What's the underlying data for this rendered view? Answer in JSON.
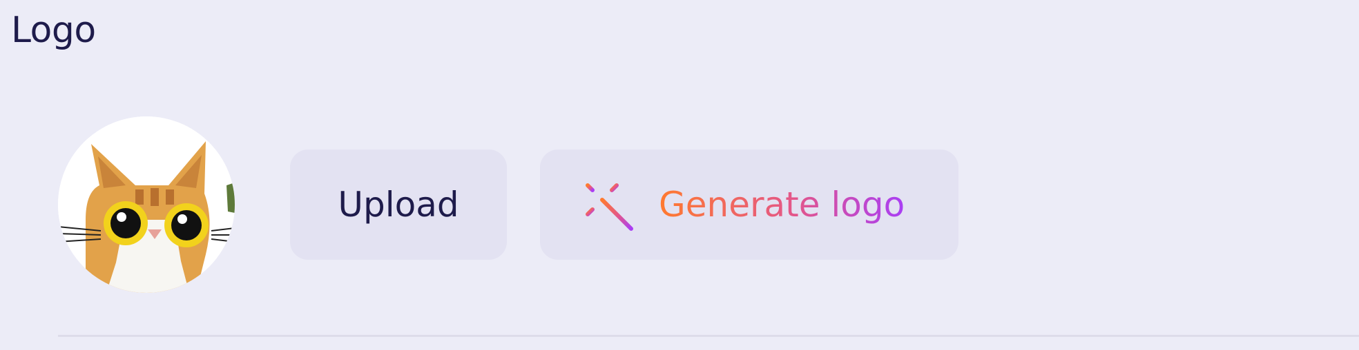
{
  "section": {
    "title": "Logo"
  },
  "logo": {
    "avatar_icon": "cat-face-avatar"
  },
  "actions": {
    "upload_label": "Upload",
    "generate_label": "Generate logo",
    "generate_icon": "magic-wand-icon"
  },
  "colors": {
    "background": "#ECECF7",
    "button_background": "#E3E2F2",
    "text_primary": "#1E1B4B",
    "gradient_start": "#FF7A2F",
    "gradient_end": "#A93EF5"
  }
}
